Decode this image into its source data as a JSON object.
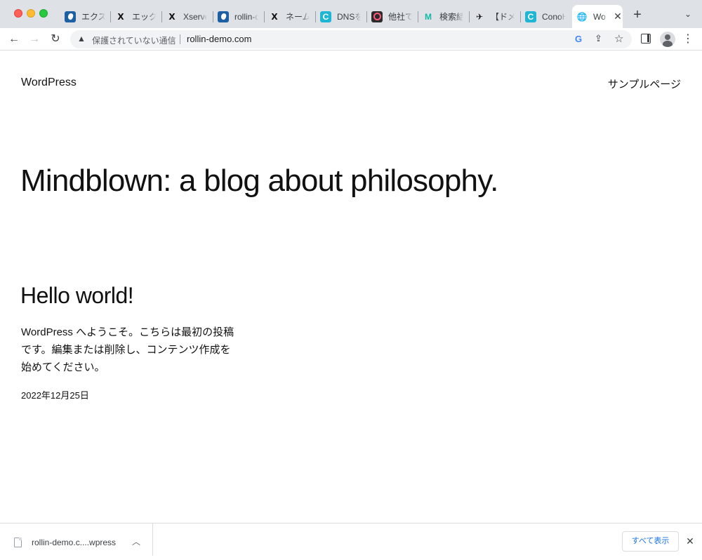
{
  "tabs": [
    {
      "title": "エクスパ",
      "icon": "wordpress-blue-icon"
    },
    {
      "title": "エックス",
      "icon": "x-logo-icon"
    },
    {
      "title": "Xserve",
      "icon": "x-logo-icon"
    },
    {
      "title": "rollin-d",
      "icon": "wordpress-blue-icon"
    },
    {
      "title": "ネーム",
      "icon": "x-logo-icon"
    },
    {
      "title": "DNSを",
      "icon": "conoha-c-icon"
    },
    {
      "title": "他社で",
      "icon": "dark-app-icon"
    },
    {
      "title": "検索結",
      "icon": "m-logo-icon"
    },
    {
      "title": "【ドメ",
      "icon": "bird-icon"
    },
    {
      "title": "ConoH",
      "icon": "conoha-c-icon"
    },
    {
      "title": "Wo",
      "icon": "globe-icon"
    }
  ],
  "toolbar": {
    "insecure_label": "保護されていない通信",
    "url": "rollin-demo.com"
  },
  "page": {
    "site_title": "WordPress",
    "nav_link": "サンプルページ",
    "tagline": "Mindblown: a blog about philosophy.",
    "post": {
      "title": "Hello world!",
      "excerpt": "WordPress へようこそ。こちらは最初の投稿です。編集または削除し、コンテンツ作成を始めてください。",
      "date": "2022年12月25日"
    }
  },
  "downloads": {
    "file_name": "rollin-demo.c....wpress",
    "show_all_label": "すべて表示"
  },
  "colors": {
    "tabstrip_bg": "#dee1e6",
    "link_blue": "#1a73e8",
    "text": "#111111"
  }
}
